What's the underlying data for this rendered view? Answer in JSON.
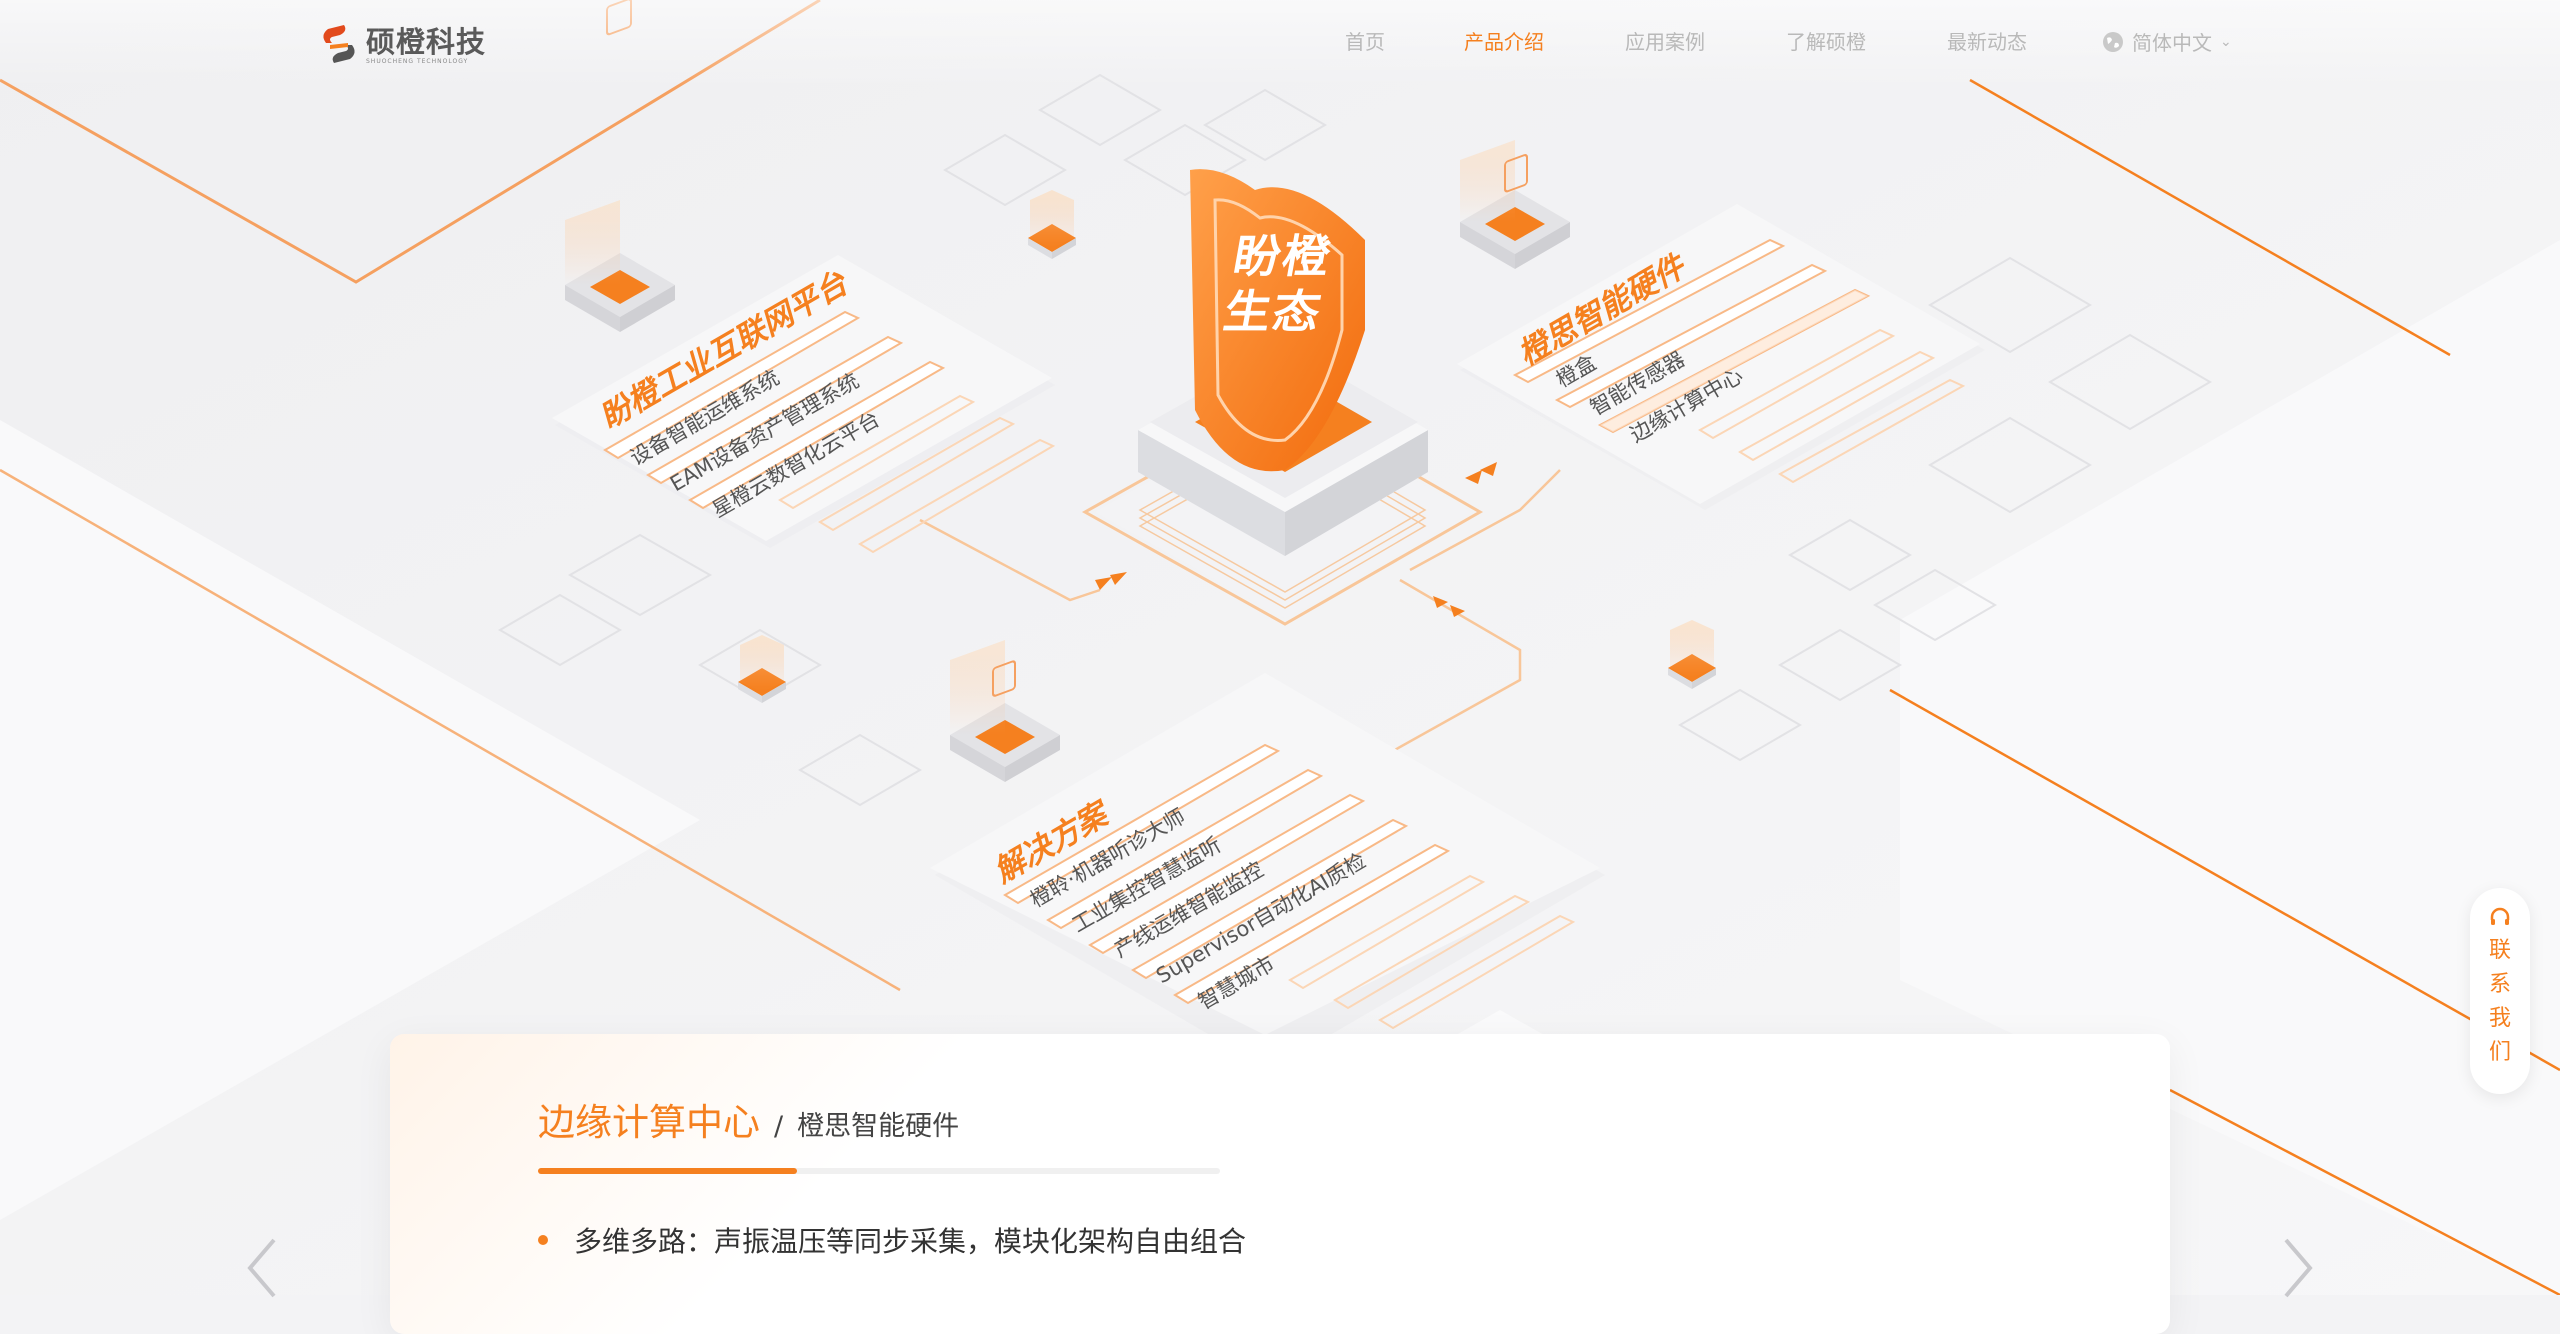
{
  "brand": {
    "name": "硕橙科技",
    "tagline": "SHUOCHENG TECHNOLOGY",
    "accent_color": "#f5801f"
  },
  "nav": {
    "items": [
      {
        "label": "首页",
        "active": false
      },
      {
        "label": "产品介绍",
        "active": true
      },
      {
        "label": "应用案例",
        "active": false
      },
      {
        "label": "了解硕橙",
        "active": false
      },
      {
        "label": "最新动态",
        "active": false
      }
    ],
    "language": {
      "label": "简体中文",
      "icon": "globe-icon"
    }
  },
  "diagram": {
    "center": {
      "label": "盼橙生态"
    },
    "platform": {
      "title": "盼橙工业互联网平台",
      "icon": "code-window-icon",
      "items": [
        "设备智能运维系统",
        "EAM设备资产管理系统",
        "星橙云数智化云平台"
      ]
    },
    "hardware": {
      "title": "橙思智能硬件",
      "icon": "sd-card-icon",
      "items": [
        "橙盒",
        "智能传感器",
        "边缘计算中心"
      ]
    },
    "solutions": {
      "title": "解决方案",
      "icon": "document-icon",
      "items": [
        "橙聆·机器听诊大师",
        "工业集控智慧监听",
        "产线运维智能监控",
        "Supervisor自动化AI质检",
        "智慧城市"
      ]
    }
  },
  "contact": {
    "label": "联系我们",
    "icon": "headset-icon"
  },
  "product_card": {
    "title": "边缘计算中心",
    "separator": "/",
    "category": "橙思智能硬件",
    "progress": 0.38,
    "features": [
      "多维多路：声振温压等同步采集，模块化架构自由组合"
    ]
  },
  "carousel": {
    "prev_icon": "chevron-left-icon",
    "next_icon": "chevron-right-icon"
  }
}
